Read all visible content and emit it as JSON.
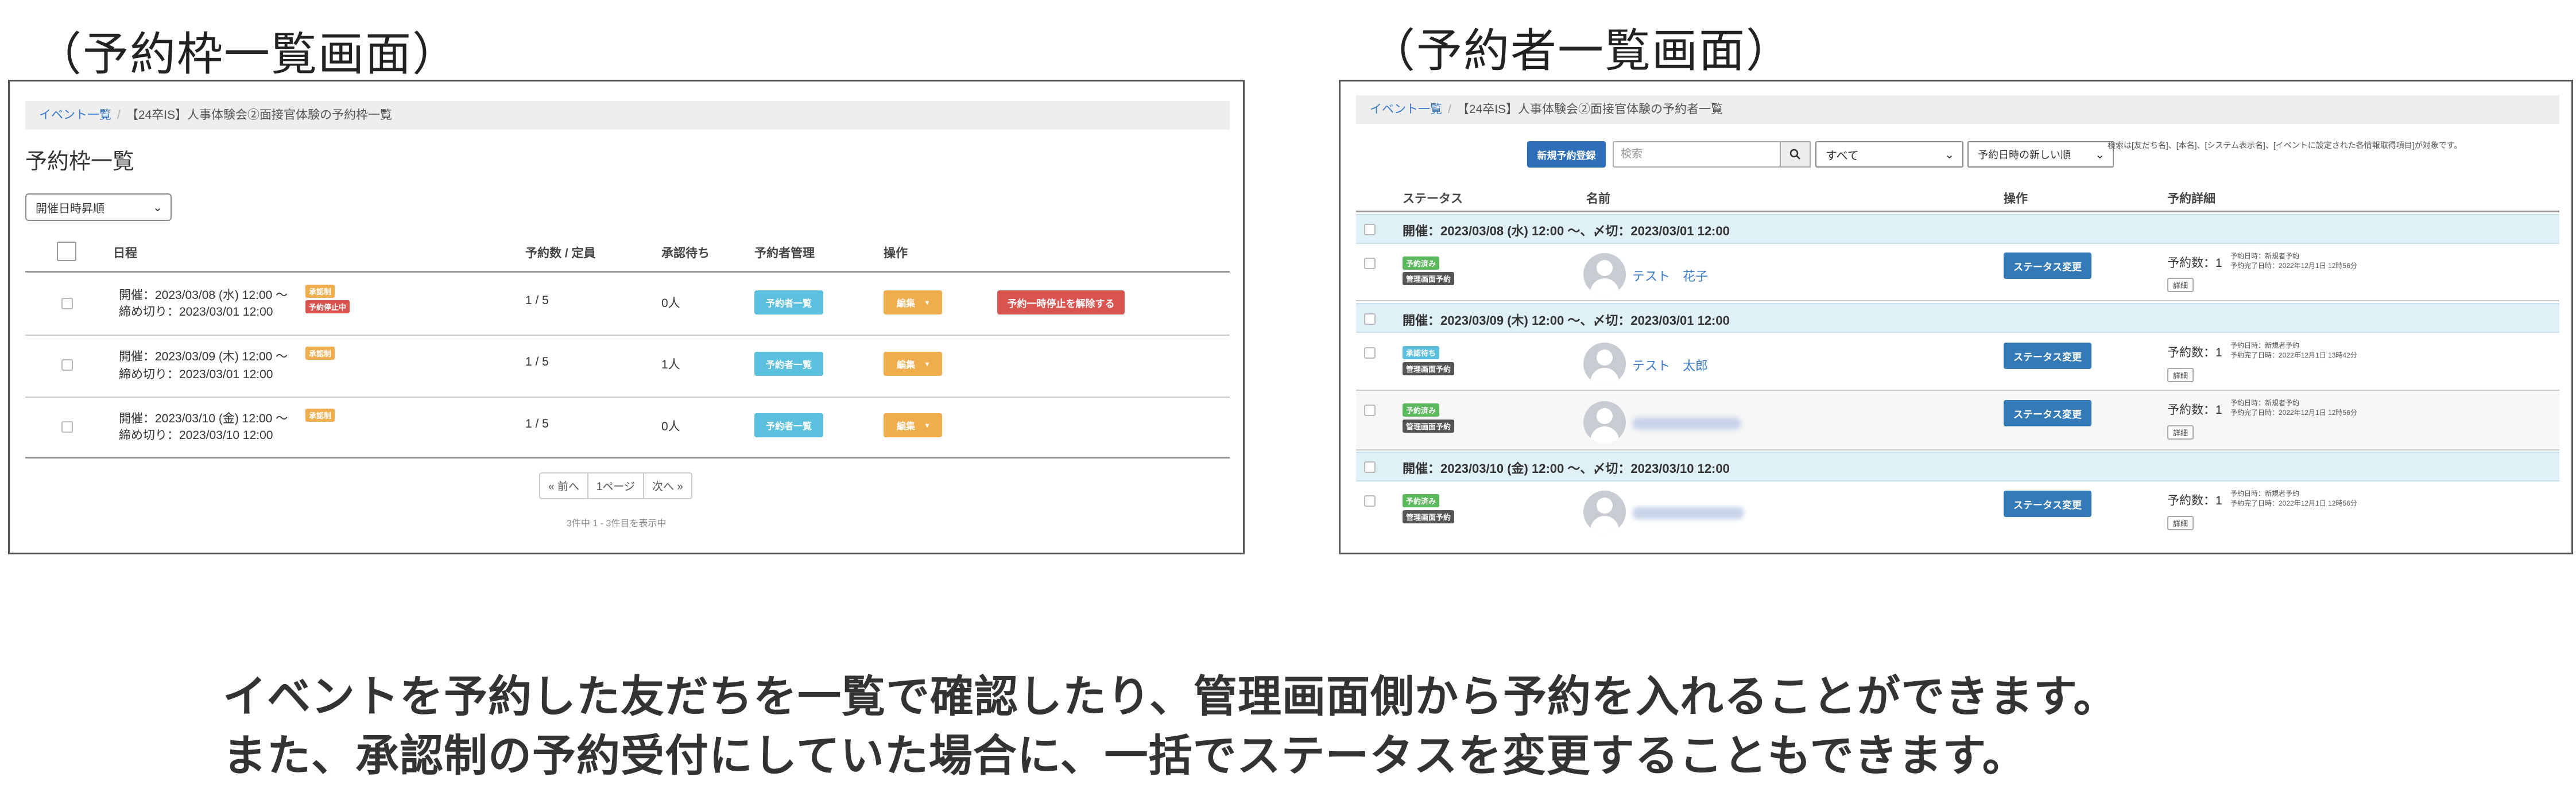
{
  "left_heading": "（予約枠一覧画面）",
  "right_heading": "（予約者一覧画面）",
  "left": {
    "breadcrumb": {
      "link": "イベント一覧",
      "sep": "/",
      "current": "【24卒IS】人事体験会②面接官体験の予約枠一覧"
    },
    "title": "予約枠一覧",
    "sort_select": "開催日時昇順",
    "columns": {
      "schedule": "日程",
      "count": "予約数 / 定員",
      "pending": "承認待ち",
      "manage": "予約者管理",
      "ops": "操作"
    },
    "rows": [
      {
        "start": "開催：2023/03/08 (水) 12:00 〜",
        "deadline": "締め切り：2023/03/01 12:00",
        "badge1": "承認制",
        "badge2": "予約停止中",
        "count": "1 / 5",
        "pending": "0人",
        "list_btn": "予約者一覧",
        "edit_btn": "編集",
        "extra_btn": "予約一時停止を解除する"
      },
      {
        "start": "開催：2023/03/09 (木) 12:00 〜",
        "deadline": "締め切り：2023/03/01 12:00",
        "badge1": "承認制",
        "count": "1 / 5",
        "pending": "1人",
        "list_btn": "予約者一覧",
        "edit_btn": "編集"
      },
      {
        "start": "開催：2023/03/10 (金) 12:00 〜",
        "deadline": "締め切り：2023/03/10 12:00",
        "badge1": "承認制",
        "count": "1 / 5",
        "pending": "0人",
        "list_btn": "予約者一覧",
        "edit_btn": "編集"
      }
    ],
    "pager": {
      "prev": "« 前へ",
      "page": "1ページ",
      "next": "次へ »"
    },
    "summary": "3件中 1 - 3件目を表示中"
  },
  "right": {
    "breadcrumb": {
      "link": "イベント一覧",
      "sep": "/",
      "current": "【24卒IS】人事体験会②面接官体験の予約者一覧"
    },
    "new_btn": "新規予約登録",
    "search_placeholder": "検索",
    "filter_select": "すべて",
    "order_select": "予約日時の新しい順",
    "search_note": "検索は[友だち名]、[本名]、[システム表示名]、[イベントに設定された各情報取得項目]が対象です。",
    "columns": {
      "status": "ステータス",
      "name": "名前",
      "ops": "操作",
      "detail": "予約詳細"
    },
    "groups": [
      {
        "label": "開催：2023/03/08 (水) 12:00 〜、〆切：2023/03/01 12:00",
        "rows": [
          {
            "status1": "予約済み",
            "status2": "管理画面予約",
            "name": "テスト　花子",
            "btn": "ステータス変更",
            "count": "予約数：1",
            "line1": "予約日時：新規者予約",
            "line2": "予約完了日時：2022年12月1日 12時56分",
            "detail_btn": "詳細"
          }
        ]
      },
      {
        "label": "開催：2023/03/09 (木) 12:00 〜、〆切：2023/03/01 12:00",
        "rows": [
          {
            "status1": "承認待ち",
            "status2": "管理画面予約",
            "name": "テスト　太郎",
            "btn": "ステータス変更",
            "count": "予約数：1",
            "line1": "予約日時：新規者予約",
            "line2": "予約完了日時：2022年12月1日 13時42分",
            "detail_btn": "詳細"
          },
          {
            "status1": "予約済み",
            "status2": "管理画面予約",
            "name": "",
            "btn": "ステータス変更",
            "count": "予約数：1",
            "line1": "予約日時：新規者予約",
            "line2": "予約完了日時：2022年12月1日 12時56分",
            "detail_btn": "詳細"
          }
        ]
      },
      {
        "label": "開催：2023/03/10 (金) 12:00 〜、〆切：2023/03/10 12:00",
        "rows": [
          {
            "status1": "予約済み",
            "status2": "管理画面予約",
            "name": "",
            "btn": "ステータス変更",
            "count": "予約数：1",
            "line1": "予約日時：新規者予約",
            "line2": "予約完了日時：2022年12月1日 12時56分",
            "detail_btn": "詳細"
          }
        ]
      }
    ]
  },
  "description": {
    "line1": "イベントを予約した友だちを一覧で確認したり、管理画面側から予約を入れることができます。",
    "line2": "また、承認制の予約受付にしていた場合に、一括でステータスを変更することもできます。"
  },
  "colors": {
    "link": "#3a7bc8",
    "badge_orange": "#f0ad4e",
    "badge_red": "#d9534f",
    "badge_green": "#5cb85c",
    "btn_cyan": "#5bc0de",
    "btn_blue": "#337ab7",
    "group_bg": "#dff0f7"
  },
  "icons": {
    "search": "search-icon",
    "chevron": "chevron-down-icon",
    "avatar": "user-avatar-icon"
  }
}
